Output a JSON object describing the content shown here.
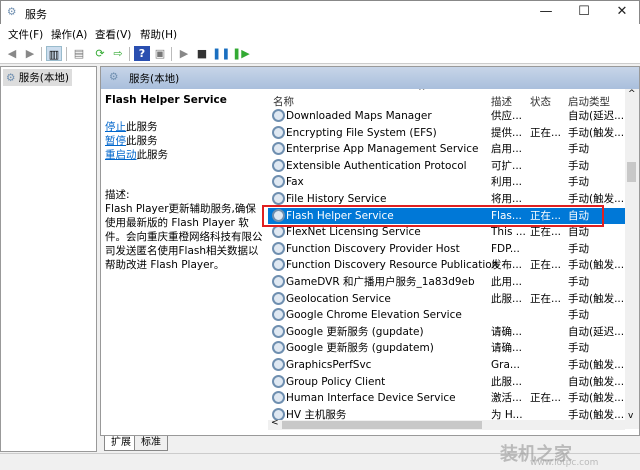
{
  "window": {
    "title": "服务",
    "min": "—",
    "max": "☐",
    "close": "✕"
  },
  "menu": [
    "文件(F)",
    "操作(A)",
    "查看(V)",
    "帮助(H)"
  ],
  "tree": {
    "root": "服务(本地)"
  },
  "panel": {
    "header": "服务(本地)"
  },
  "details": {
    "service_name": "Flash Helper Service",
    "actions": [
      {
        "link": "停止",
        "suffix": "此服务"
      },
      {
        "link": "暂停",
        "suffix": "此服务"
      },
      {
        "link": "重启动",
        "suffix": "此服务"
      }
    ],
    "desc_label": "描述:",
    "description": "Flash Player更新辅助服务,确保使用最新版的 Flash Player 软件。会向重庆重橙网络科技有限公司发送匿名使用Flash相关数据以帮助改进 Flash Player。"
  },
  "columns": {
    "name": "名称",
    "desc": "描述",
    "status": "状态",
    "startup": "启动类型"
  },
  "rows": [
    {
      "name": "Downloaded Maps Manager",
      "desc": "供应...",
      "status": "",
      "startup": "自动(延迟..."
    },
    {
      "name": "Encrypting File System (EFS)",
      "desc": "提供...",
      "status": "正在...",
      "startup": "手动(触发..."
    },
    {
      "name": "Enterprise App Management Service",
      "desc": "启用...",
      "status": "",
      "startup": "手动"
    },
    {
      "name": "Extensible Authentication Protocol",
      "desc": "可扩...",
      "status": "",
      "startup": "手动"
    },
    {
      "name": "Fax",
      "desc": "利用...",
      "status": "",
      "startup": "手动"
    },
    {
      "name": "File History Service",
      "desc": "将用...",
      "status": "",
      "startup": "手动(触发..."
    },
    {
      "name": "Flash Helper Service",
      "desc": "Flas...",
      "status": "正在...",
      "startup": "自动"
    },
    {
      "name": "FlexNet Licensing Service",
      "desc": "This ...",
      "status": "正在...",
      "startup": "自动"
    },
    {
      "name": "Function Discovery Provider Host",
      "desc": "FDP...",
      "status": "",
      "startup": "手动"
    },
    {
      "name": "Function Discovery Resource Publication",
      "desc": "发布...",
      "status": "正在...",
      "startup": "手动(触发..."
    },
    {
      "name": "GameDVR 和广播用户服务_1a83d9eb",
      "desc": "此用...",
      "status": "",
      "startup": "手动"
    },
    {
      "name": "Geolocation Service",
      "desc": "此服...",
      "status": "正在...",
      "startup": "手动(触发..."
    },
    {
      "name": "Google Chrome Elevation Service",
      "desc": "",
      "status": "",
      "startup": "手动"
    },
    {
      "name": "Google 更新服务 (gupdate)",
      "desc": "请确...",
      "status": "",
      "startup": "自动(延迟..."
    },
    {
      "name": "Google 更新服务 (gupdatem)",
      "desc": "请确...",
      "status": "",
      "startup": "手动"
    },
    {
      "name": "GraphicsPerfSvc",
      "desc": "Gra...",
      "status": "",
      "startup": "手动(触发..."
    },
    {
      "name": "Group Policy Client",
      "desc": "此服...",
      "status": "",
      "startup": "自动(触发..."
    },
    {
      "name": "Human Interface Device Service",
      "desc": "激活...",
      "status": "正在...",
      "startup": "手动(触发..."
    },
    {
      "name": "HV 主机服务",
      "desc": "为 H...",
      "status": "",
      "startup": "手动(触发..."
    }
  ],
  "selected_index": 6,
  "tabs": [
    "扩展",
    "标准"
  ],
  "watermark": {
    "text": "装机之家",
    "url": "www.lotpc.com"
  }
}
